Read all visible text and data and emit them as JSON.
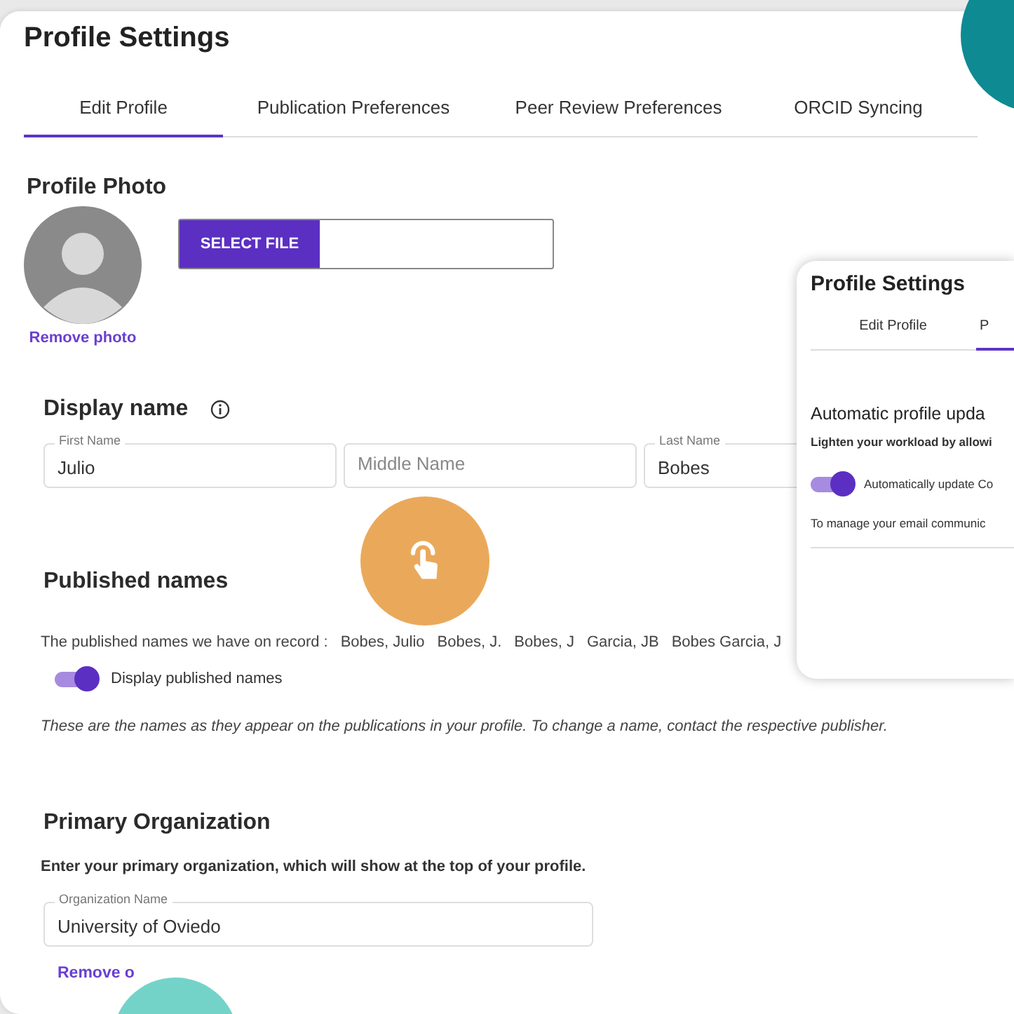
{
  "title": "Profile Settings",
  "tabs": [
    {
      "label": "Edit Profile",
      "selected": true
    },
    {
      "label": "Publication Preferences",
      "selected": false
    },
    {
      "label": "Peer Review Preferences",
      "selected": false
    },
    {
      "label": "ORCID Syncing",
      "selected": false
    }
  ],
  "profile_photo": {
    "heading": "Profile Photo",
    "select_button": "SELECT FILE",
    "remove_link": "Remove photo"
  },
  "display_name": {
    "heading": "Display name",
    "fields": [
      {
        "label": "First Name",
        "value": "Julio"
      },
      {
        "placeholder": "Middle Name"
      },
      {
        "label": "Last Name",
        "value": "Bobes"
      }
    ]
  },
  "published_names": {
    "heading": "Published names",
    "intro": "The published names we have on record :",
    "names": [
      "Bobes, Julio",
      "Bobes, J.",
      "Bobes, J",
      "Garcia, JB",
      "Bobes Garcia, J"
    ],
    "toggle": {
      "label": "Display published names",
      "on": true
    },
    "note": "These are the names as they appear on the publications in your profile. To change a name, contact the respective publisher."
  },
  "primary_organization": {
    "heading": "Primary Organization",
    "description": "Enter your primary organization, which will show at the top of your profile.",
    "field": {
      "label": "Organization Name",
      "value": "University of Oviedo"
    },
    "remove_link": "Remove o"
  },
  "overlay_window": {
    "title": "Profile Settings",
    "tabs": [
      {
        "label": "Edit Profile",
        "selected": false
      },
      {
        "label": "P",
        "selected": true
      }
    ],
    "heading": "Automatic profile upda",
    "description": "Lighten your workload by allowi",
    "toggle": {
      "label": "Automatically update Co",
      "on": true
    },
    "footnote": "To manage your email communic"
  }
}
